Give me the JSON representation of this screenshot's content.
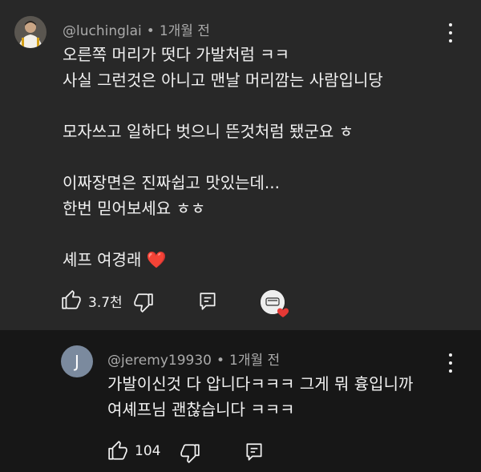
{
  "main_comment": {
    "author": "@luchinglai",
    "separator": "•",
    "time": "1개월 전",
    "lines": [
      "오른쪽 머리가 떳다 가발처럼 ㅋㅋ",
      "사실 그런것은 아니고 맨날 머리깜는 사람입니당",
      "",
      "모자쓰고 일하다 벗으니 뜬것처럼 됐군요 ㅎ",
      "",
      "이짜장면은 진짜쉽고 맛있는데...",
      "한번 믿어보세요 ㅎㅎ",
      "",
      "셰프 여경래 ❤️"
    ],
    "likes": "3.7천"
  },
  "reply_comment": {
    "avatar_letter": "J",
    "author": "@jeremy19930",
    "separator": "•",
    "time": "1개월 전",
    "lines": [
      "가발이신것 다 압니다ㅋㅋㅋ 그게 뭐 흉입니까",
      "여셰프님 괜찮습니다 ㅋㅋㅋ"
    ],
    "likes": "104"
  },
  "colors": {
    "main_bg": "#282828",
    "reply_bg": "#171717",
    "text": "#f1f1f1",
    "meta": "#aaaaaa",
    "heart": "#e53935"
  }
}
